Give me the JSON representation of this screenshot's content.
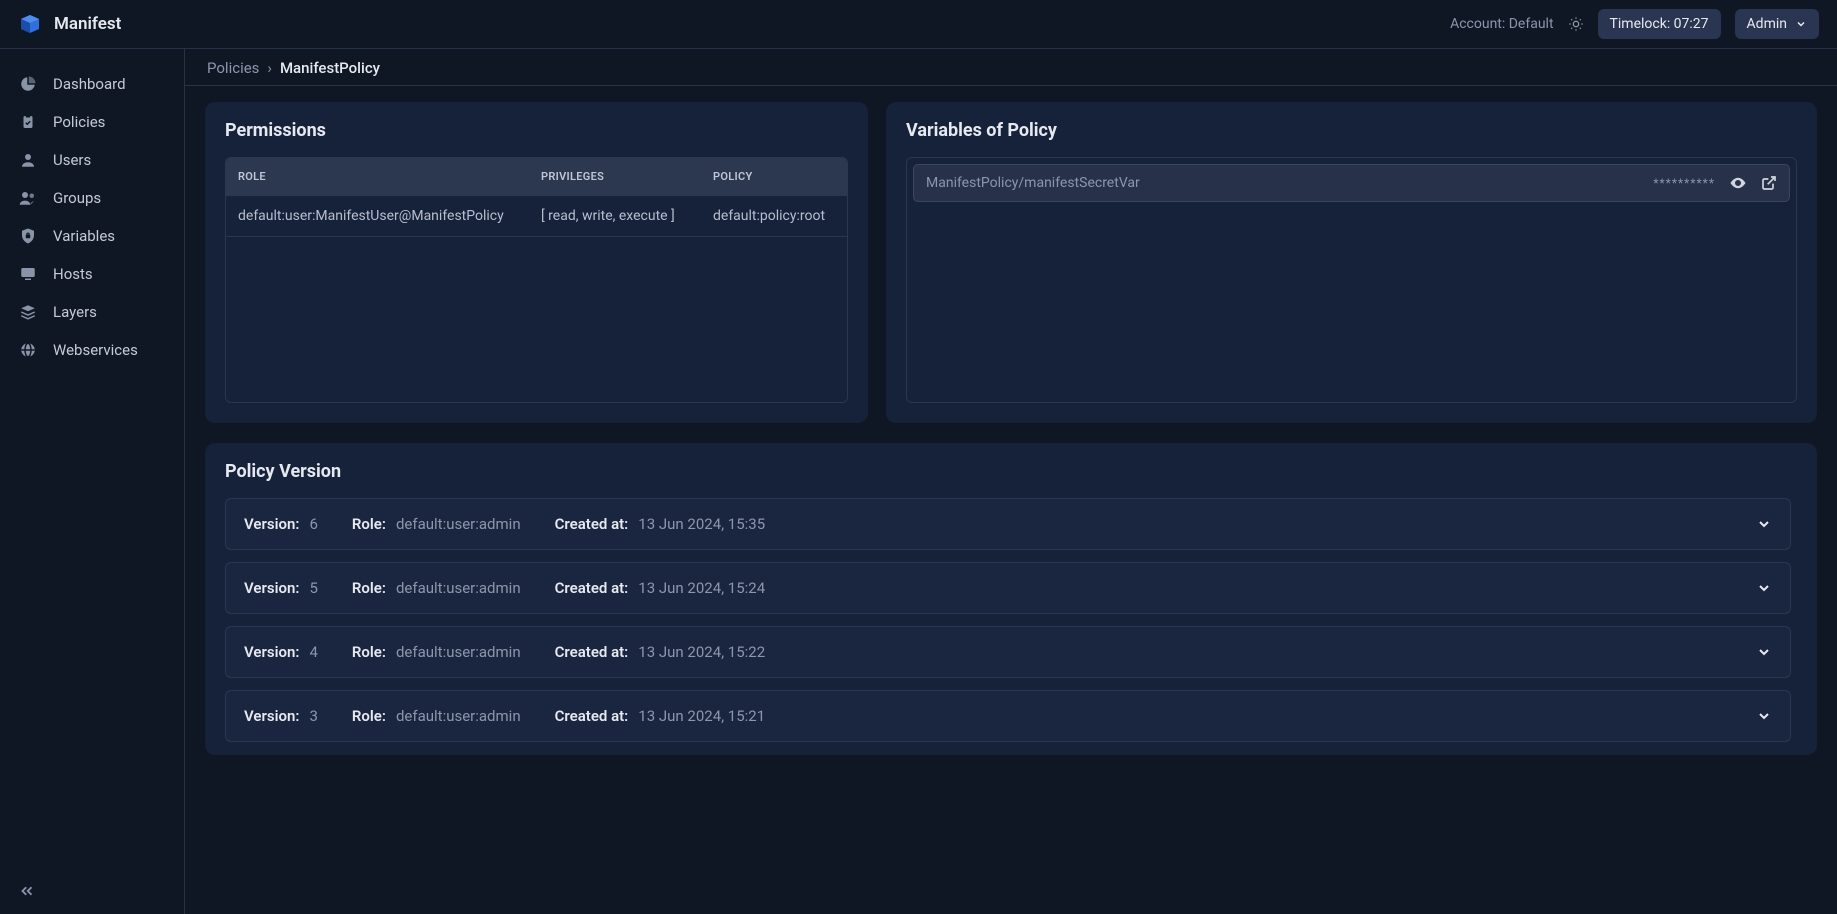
{
  "app": {
    "name": "Manifest"
  },
  "header": {
    "account_label": "Account: Default",
    "timelock": "Timelock: 07:27",
    "user": "Admin"
  },
  "sidebar": {
    "items": [
      {
        "label": "Dashboard",
        "icon": "pie-chart-icon"
      },
      {
        "label": "Policies",
        "icon": "clipboard-check-icon"
      },
      {
        "label": "Users",
        "icon": "user-icon"
      },
      {
        "label": "Groups",
        "icon": "users-icon"
      },
      {
        "label": "Variables",
        "icon": "shield-lock-icon"
      },
      {
        "label": "Hosts",
        "icon": "monitor-icon"
      },
      {
        "label": "Layers",
        "icon": "layers-icon"
      },
      {
        "label": "Webservices",
        "icon": "globe-icon"
      }
    ]
  },
  "breadcrumb": {
    "root": "Policies",
    "current": "ManifestPolicy"
  },
  "permissions": {
    "title": "Permissions",
    "columns": {
      "role": "ROLE",
      "privileges": "PRIVILEGES",
      "policy": "POLICY"
    },
    "rows": [
      {
        "role": "default:user:ManifestUser@ManifestPolicy",
        "privileges": "[ read, write, execute ]",
        "policy": "default:policy:root"
      }
    ]
  },
  "variables": {
    "title": "Variables of Policy",
    "rows": [
      {
        "name": "ManifestPolicy/manifestSecretVar",
        "value": "**********"
      }
    ]
  },
  "versions": {
    "title": "Policy Version",
    "labels": {
      "version": "Version:",
      "role": "Role:",
      "created": "Created at:"
    },
    "rows": [
      {
        "version": "6",
        "role": "default:user:admin",
        "created": "13 Jun 2024, 15:35"
      },
      {
        "version": "5",
        "role": "default:user:admin",
        "created": "13 Jun 2024, 15:24"
      },
      {
        "version": "4",
        "role": "default:user:admin",
        "created": "13 Jun 2024, 15:22"
      },
      {
        "version": "3",
        "role": "default:user:admin",
        "created": "13 Jun 2024, 15:21"
      }
    ]
  }
}
